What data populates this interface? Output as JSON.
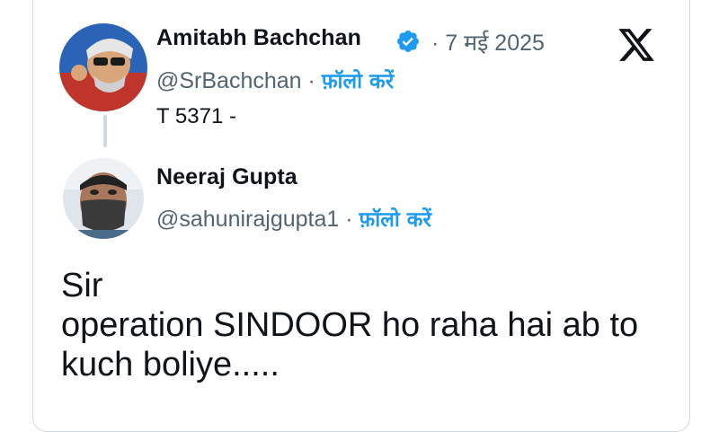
{
  "original_post": {
    "author_name": "Amitabh Bachchan",
    "handle": "@SrBachchan",
    "separator": "·",
    "date": "· 7 मई 2025",
    "follow_label": "फ़ॉलो करें",
    "text": "T 5371 -",
    "verified": true
  },
  "reply": {
    "author_name": "Neeraj Gupta",
    "handle": "@sahunirajgupta1",
    "separator": "·",
    "follow_label": "फ़ॉलो करें",
    "text": "Sir\noperation SINDOOR ho raha hai ab to\nkuch boliye....."
  },
  "icons": {
    "brand": "x-logo-icon",
    "verified": "verified-badge-icon"
  },
  "colors": {
    "link_blue": "#1d9bf0",
    "muted": "#536471",
    "text": "#0f1419",
    "border": "#cfd9de"
  }
}
